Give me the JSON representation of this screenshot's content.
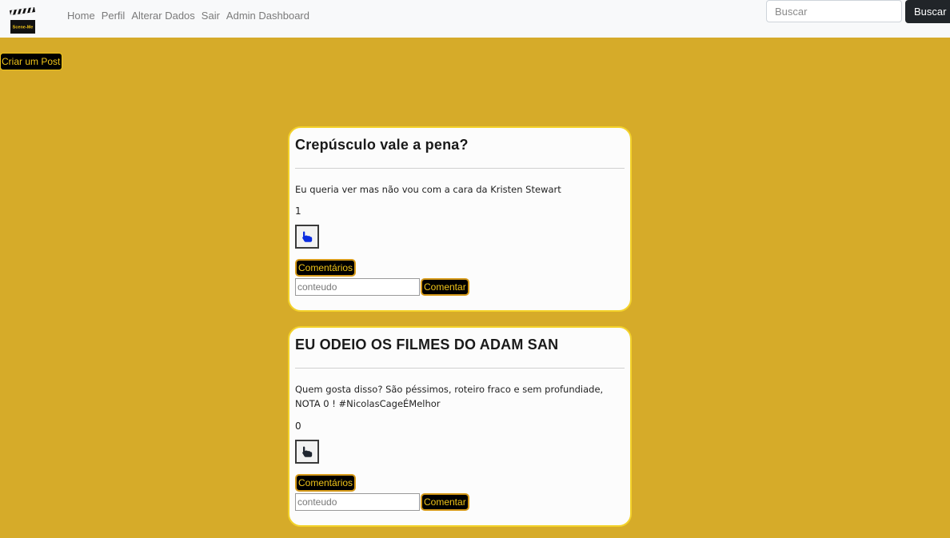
{
  "brand": {
    "logo_text": "Scene-Me",
    "logo_icon": "clapperboard-icon"
  },
  "nav": {
    "items": [
      {
        "label": "Home"
      },
      {
        "label": "Perfil"
      },
      {
        "label": "Alterar Dados"
      },
      {
        "label": "Sair"
      },
      {
        "label": "Admin Dashboard"
      }
    ]
  },
  "search": {
    "placeholder": "Buscar",
    "value": "",
    "button_label": "Buscar"
  },
  "create_post": {
    "label": "Criar um Post"
  },
  "posts": [
    {
      "title": "Crepúsculo vale a pena?",
      "body": "Eu queria ver mas não vou com a cara da Kristen Stewart",
      "likes": "1",
      "like_icon": "hand-pointer-icon",
      "like_icon_color": "#0A2BE0",
      "comments_label": "Comentários",
      "comment_placeholder": "conteudo",
      "comment_button": "Comentar"
    },
    {
      "title": "EU ODEIO OS FILMES DO ADAM SAN",
      "body": "Quem gosta disso? São péssimos, roteiro fraco e sem profundiade, NOTA 0 ! #NicolasCageÉMelhor",
      "likes": "0",
      "like_icon": "hand-pointer-icon",
      "like_icon_color": "#1f2630",
      "comments_label": "Comentários",
      "comment_placeholder": "conteudo",
      "comment_button": "Comentar"
    }
  ],
  "colors": {
    "background": "#D6AB29",
    "card_border": "#F3D22A",
    "button_text": "#F0C419"
  }
}
